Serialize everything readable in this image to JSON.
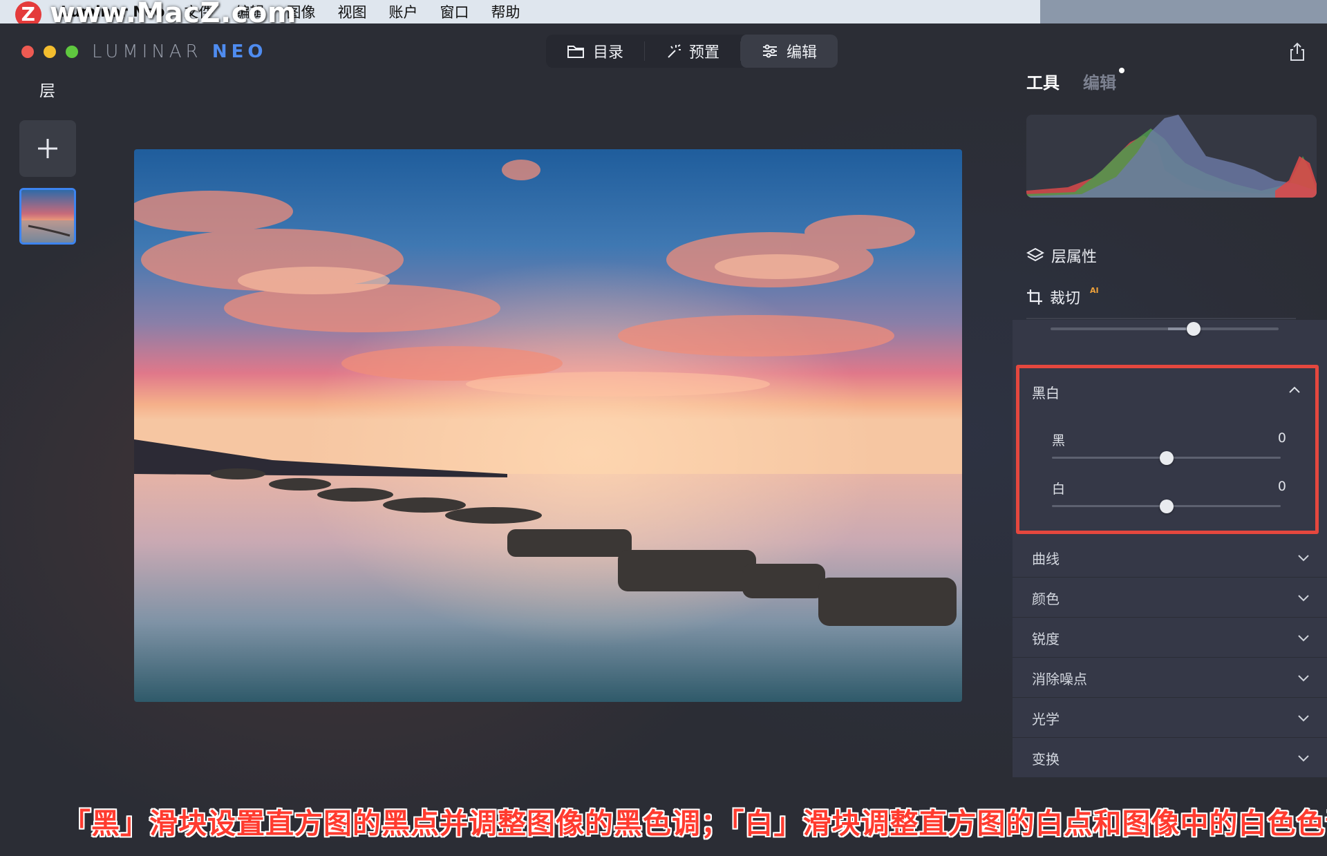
{
  "menubar": {
    "app_name": "Luminar Neo",
    "items": [
      "文件",
      "编辑",
      "图像",
      "视图",
      "账户",
      "窗口",
      "帮助"
    ]
  },
  "watermark": {
    "badge": "Z",
    "text": "www.MacZ.com"
  },
  "brand": {
    "prefix": "LUMINAR ",
    "neo": "NEO"
  },
  "topnav": {
    "tabs": [
      {
        "label": "目录",
        "icon": "folder-icon"
      },
      {
        "label": "预置",
        "icon": "magic-wand-icon"
      },
      {
        "label": "编辑",
        "icon": "sliders-icon",
        "active": true
      }
    ]
  },
  "layers": {
    "title": "层"
  },
  "panel": {
    "tab_tools": "工具",
    "tab_edits": "编辑",
    "layer_props": "层属性",
    "crop": "裁切",
    "crop_ai": "AI"
  },
  "bw": {
    "title": "黑白",
    "black_label": "黑",
    "black_value": "0",
    "white_label": "白",
    "white_value": "0"
  },
  "sections": [
    "曲线",
    "颜色",
    "锐度",
    "消除噪点",
    "光学",
    "变换"
  ],
  "caption": "「黑」滑块设置直方图的黑点并调整图像的黑色调；「白」滑块调整直方图的白点和图像中的白色色调",
  "colors": {
    "accent": "#3d84f0",
    "highlight": "#e5473e",
    "panel": "#353847"
  }
}
